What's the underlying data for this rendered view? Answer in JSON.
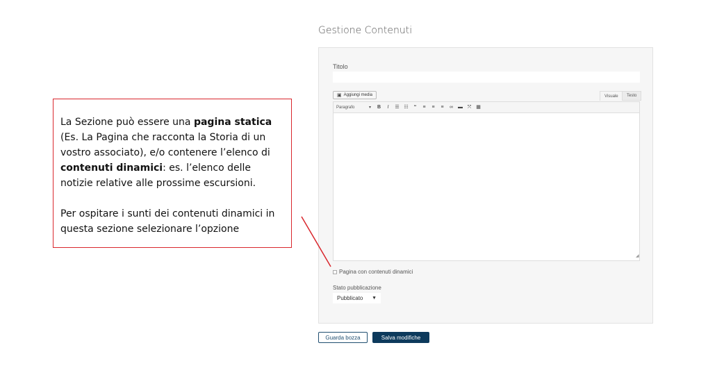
{
  "page": {
    "title": "Gestione Contenuti"
  },
  "form": {
    "title_label": "Titolo",
    "title_value": "",
    "add_media_label": "Aggiungi media",
    "tabs": {
      "visual": "Visuale",
      "text": "Testo"
    },
    "toolbar": {
      "format_value": "Paragrafo",
      "buttons": [
        "bold-icon",
        "italic-icon",
        "bullet-list-icon",
        "numbered-list-icon",
        "blockquote-icon",
        "align-left-icon",
        "align-center-icon",
        "align-right-icon",
        "link-icon",
        "read-more-icon",
        "fullscreen-icon",
        "toolbar-toggle-icon"
      ]
    },
    "editor_content": "",
    "dynamic_checkbox_label": "Pagina con contenuti dinamici",
    "dynamic_checked": false,
    "status_label": "Stato pubblicazione",
    "status_value": "Pubblicato"
  },
  "actions": {
    "draft": "Guarda bozza",
    "save": "Salva modifiche"
  },
  "callout": {
    "p1_a": "La Sezione può essere una ",
    "p1_b": "pagina statica",
    "p1_c": " (Es. La Pagina che racconta la Storia di un vostro associato), e/o contenere l’elenco di ",
    "p1_d": "contenuti dinamici",
    "p1_e": ": es. l’elenco delle notizie relative alle prossime escursioni.",
    "p2": "Per ospitare i sunti dei contenuti dinamici in questa sezione selezionare l’opzione"
  },
  "colors": {
    "callout_border": "#d9262c",
    "primary_button": "#0d3a5c"
  }
}
